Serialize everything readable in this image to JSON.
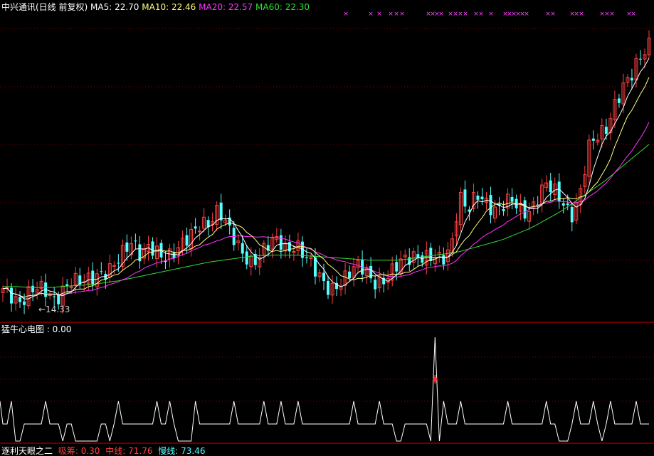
{
  "header": {
    "title": "中兴通讯(日线 前复权)",
    "ma5_label": "MA5: 22.70",
    "ma10_label": "MA10: 22.46",
    "ma20_label": "MA20: 22.57",
    "ma60_label": "MA60: 22.30"
  },
  "colors": {
    "background": "#000000",
    "grid": "#8b0000",
    "up": "#ff4040",
    "down": "#54ffff",
    "ma5": "#ffffff",
    "ma10": "#ffff80",
    "ma20": "#ff33ff",
    "ma60": "#33dd33",
    "marker": "#ff44ff"
  },
  "price_panel": {
    "low_annotation": "←14.33"
  },
  "indicator_panel": {
    "label": "猛牛心电图 : 0.00"
  },
  "bottom_panel": {
    "label": "逐利天眼之二",
    "values": [
      {
        "text": "吸筹: 0.30",
        "color": "#ff4040"
      },
      {
        "text": "中线: 71.76",
        "color": "#ff4040"
      },
      {
        "text": "慢线: 73.46",
        "color": "#54ffff"
      }
    ]
  },
  "chart_data": {
    "type": "candlestick",
    "min_low": 14.33,
    "ma_current": {
      "MA5": 22.7,
      "MA10": 22.46,
      "MA20": 22.57,
      "MA60": 22.3
    },
    "close_path": [
      15.2,
      15.0,
      14.6,
      14.9,
      15.1,
      15.0,
      14.7,
      15.3,
      15.6,
      15.4,
      15.5,
      15.9,
      16.2,
      16.5,
      16.9,
      17.3,
      16.8,
      17.5,
      17.1,
      16.6,
      16.8,
      17.4,
      18.1,
      18.6,
      18.4,
      18.9,
      18.2,
      17.6,
      17.0,
      16.5,
      16.8,
      17.3,
      17.6,
      17.2,
      17.5,
      16.8,
      16.1,
      15.5,
      15.2,
      15.6,
      15.9,
      16.2,
      16.0,
      15.5,
      15.7,
      16.1,
      16.4,
      16.5,
      16.7,
      16.9,
      17.0,
      16.6,
      16.9,
      19.6,
      19.2,
      20.1,
      19.5,
      18.8,
      19.1,
      19.7,
      19.3,
      19.0,
      19.4,
      20.2,
      20.0,
      19.6,
      18.9,
      19.8,
      22.0,
      22.6,
      23.1,
      24.4,
      25.2,
      25.6,
      26.4,
      27.2
    ],
    "ma60_path": [
      15.3,
      15.3,
      15.25,
      15.25,
      15.3,
      15.35,
      15.4,
      15.5,
      15.6,
      15.75,
      15.9,
      16.05,
      16.2,
      16.35,
      16.5,
      16.6,
      16.7,
      16.8,
      16.85,
      16.85,
      16.85,
      16.8,
      16.75,
      16.7,
      16.65,
      16.6,
      16.6,
      16.6,
      16.7,
      16.8,
      16.9,
      17.0,
      17.2,
      17.4,
      17.6,
      17.9,
      18.2,
      18.6,
      19.0,
      19.5,
      20.0,
      20.5,
      21.1,
      21.7,
      22.3
    ],
    "peak_markers": 5,
    "indicator_baseline": 0,
    "indicator_spike": 6
  }
}
